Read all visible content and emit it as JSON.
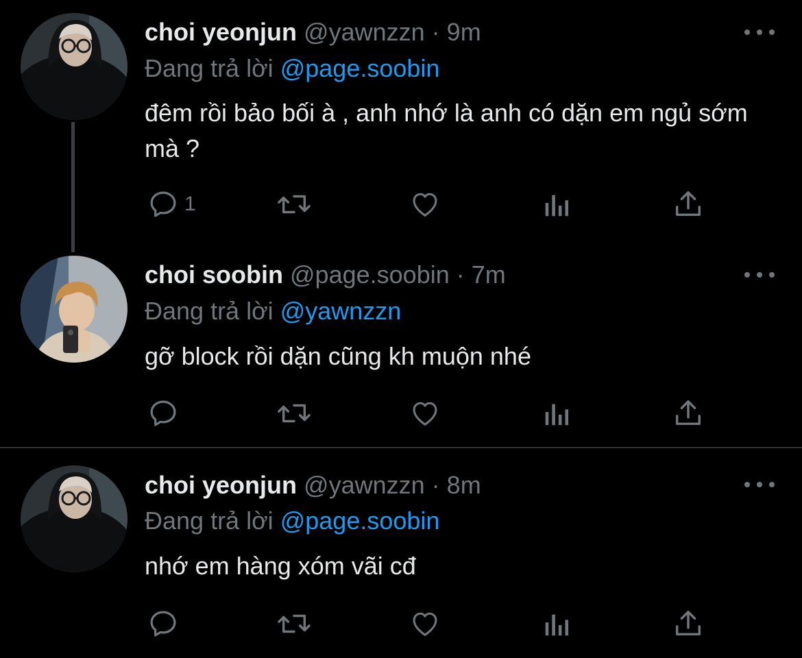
{
  "theme": {
    "background": "#000000",
    "text_primary": "#e7e9ea",
    "text_secondary": "#71767b",
    "accent": "#1d9bf0",
    "divider": "#2f3336"
  },
  "tweets": [
    {
      "display_name": "choi yeonjun",
      "handle": "@yawnzzn",
      "separator": "·",
      "time": "9m",
      "reply_prefix": "Đang trả lời",
      "reply_to": "@page.soobin",
      "text": "đêm rồi bảo bối à , anh nhớ là anh có dặn em ngủ sớm mà ?",
      "reply_count": "1",
      "icons": [
        "reply-icon",
        "retweet-icon",
        "like-icon",
        "analytics-icon",
        "share-icon"
      ]
    },
    {
      "display_name": "choi soobin",
      "handle": "@page.soobin",
      "separator": "·",
      "time": "7m",
      "reply_prefix": "Đang trả lời",
      "reply_to": "@yawnzzn",
      "text": "gỡ block rồi dặn cũng kh muộn nhé",
      "reply_count": "",
      "icons": [
        "reply-icon",
        "retweet-icon",
        "like-icon",
        "analytics-icon",
        "share-icon"
      ]
    },
    {
      "display_name": "choi yeonjun",
      "handle": "@yawnzzn",
      "separator": "·",
      "time": "8m",
      "reply_prefix": "Đang trả lời",
      "reply_to": "@page.soobin",
      "text": "nhớ em hàng xóm vãi cđ",
      "reply_count": "",
      "icons": [
        "reply-icon",
        "retweet-icon",
        "like-icon",
        "analytics-icon",
        "share-icon"
      ]
    }
  ]
}
